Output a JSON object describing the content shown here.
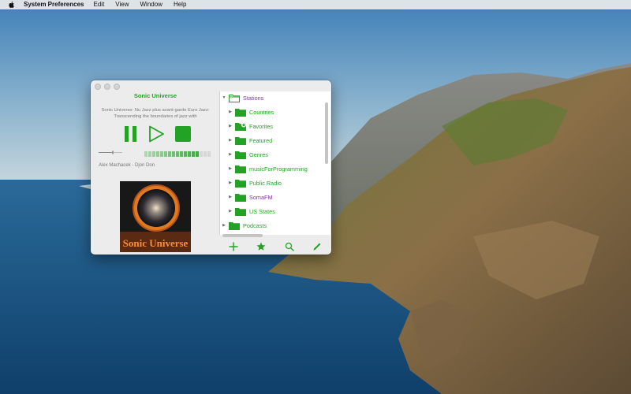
{
  "menubar": {
    "app_name": "System Preferences",
    "items": [
      "Edit",
      "View",
      "Window",
      "Help"
    ]
  },
  "player": {
    "station_title": "Sonic Universe",
    "description": "Sonic Universe: Nu Jazz plus avant-garde Euro Jazz: Transcending the boundaries of jazz with",
    "now_playing": "Alex Machacek - Djon Don",
    "artwork_text": "Sonic Universe",
    "volume": 0.6,
    "level_bars_lit": 14,
    "level_bars_total": 17
  },
  "tree": {
    "root": "Stations",
    "children": [
      {
        "label": "Countries",
        "icon": "folder-icon"
      },
      {
        "label": "Favorites",
        "icon": "favorites-folder-icon"
      },
      {
        "label": "Featured",
        "icon": "folder-icon"
      },
      {
        "label": "Genres",
        "icon": "folder-icon"
      },
      {
        "label": "musicForProgramming",
        "icon": "folder-icon"
      },
      {
        "label": "Public Radio",
        "icon": "folder-icon"
      },
      {
        "label": "SomaFM",
        "icon": "folder-icon"
      },
      {
        "label": "US States",
        "icon": "folder-icon"
      }
    ],
    "sibling": "Podcasts"
  },
  "toolbar": {
    "icons": [
      "add-icon",
      "star-icon",
      "search-icon",
      "edit-icon"
    ]
  },
  "colors": {
    "accent_green": "#22a325",
    "accent_purple": "#8a2fb5"
  }
}
